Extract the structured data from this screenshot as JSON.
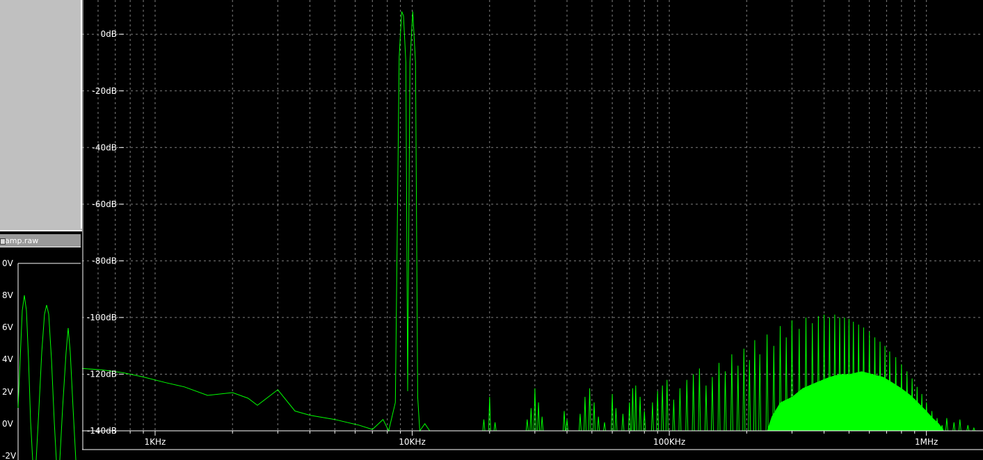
{
  "mini_window": {
    "title": "amp.raw",
    "y_ticks": [
      "0V",
      "8V",
      "6V",
      "4V",
      "2V",
      "0V",
      "-2V"
    ]
  },
  "colors": {
    "background": "#000000",
    "trace": "#00ff00",
    "grid": "#808080",
    "text": "#ffffff",
    "panel": "#c0c0c0"
  },
  "chart_data": {
    "type": "line",
    "title": "",
    "xlabel": "",
    "ylabel": "",
    "x_scale": "log",
    "x_unit": "Hz",
    "xlim": [
      520,
      1660000
    ],
    "ylim": [
      -140,
      10
    ],
    "grid": true,
    "x_tick_labels": [
      {
        "value": 1000,
        "label": "1KHz"
      },
      {
        "value": 10000,
        "label": "10KHz"
      },
      {
        "value": 100000,
        "label": "100KHz"
      },
      {
        "value": 1000000,
        "label": "1MHz"
      }
    ],
    "y_tick_labels": [
      {
        "value": 0,
        "label": "0dB"
      },
      {
        "value": -20,
        "label": "-20dB"
      },
      {
        "value": -40,
        "label": "-40dB"
      },
      {
        "value": -60,
        "label": "-60dB"
      },
      {
        "value": -80,
        "label": "-80dB"
      },
      {
        "value": -100,
        "label": "-100dB"
      },
      {
        "value": -120,
        "label": "-120dB"
      },
      {
        "value": -140,
        "label": "-140dB"
      }
    ],
    "series": [
      {
        "points": [
          [
            520,
            -118
          ],
          [
            620,
            -118.5
          ],
          [
            750,
            -119.5
          ],
          [
            900,
            -121
          ],
          [
            1100,
            -123
          ],
          [
            1300,
            -124.5
          ],
          [
            1600,
            -127.5
          ],
          [
            2000,
            -126.5
          ],
          [
            2300,
            -128.5
          ],
          [
            2500,
            -131
          ],
          [
            3000,
            -125.5
          ],
          [
            3500,
            -133
          ],
          [
            4000,
            -134.5
          ],
          [
            5000,
            -136
          ],
          [
            6200,
            -138
          ],
          [
            7000,
            -139.5
          ],
          [
            7700,
            -136
          ],
          [
            8100,
            -140
          ],
          [
            8600,
            -130
          ],
          [
            8900,
            -8
          ],
          [
            9100,
            8
          ],
          [
            9250,
            6.5
          ],
          [
            9450,
            -10
          ],
          [
            9600,
            -126
          ],
          [
            9800,
            -10
          ],
          [
            10050,
            8
          ],
          [
            10300,
            -10
          ],
          [
            10500,
            -128
          ],
          [
            10700,
            -140
          ],
          [
            11200,
            -137.5
          ],
          [
            11700,
            -140
          ]
        ]
      }
    ],
    "harmonic_peaks": [
      [
        17500,
        -140
      ],
      [
        19000,
        -136
      ],
      [
        20000,
        -128
      ],
      [
        21000,
        -137
      ],
      [
        22000,
        -140
      ],
      [
        28000,
        -136
      ],
      [
        29000,
        -132
      ],
      [
        30000,
        -125
      ],
      [
        31000,
        -130
      ],
      [
        32000,
        -135
      ],
      [
        33000,
        -140
      ],
      [
        37000,
        -140
      ],
      [
        39000,
        -133
      ],
      [
        40000,
        -136
      ],
      [
        45000,
        -134
      ],
      [
        47000,
        -128
      ],
      [
        49000,
        -125
      ],
      [
        51000,
        -130
      ],
      [
        53000,
        -135
      ],
      [
        56000,
        -137
      ],
      [
        60000,
        -127
      ],
      [
        62000,
        -132
      ],
      [
        66000,
        -134
      ],
      [
        70000,
        -130
      ],
      [
        72000,
        -125
      ],
      [
        74000,
        -124
      ],
      [
        77000,
        -128
      ],
      [
        80000,
        -133
      ],
      [
        86000,
        -130
      ],
      [
        90000,
        -126
      ],
      [
        94000,
        -124
      ],
      [
        98000,
        -122
      ],
      [
        104000,
        -129
      ],
      [
        110000,
        -125
      ],
      [
        117000,
        -122
      ],
      [
        124000,
        -120
      ],
      [
        131000,
        -118
      ],
      [
        139000,
        -124
      ],
      [
        147000,
        -121
      ],
      [
        156000,
        -116
      ],
      [
        165000,
        -119
      ],
      [
        175000,
        -113
      ],
      [
        185000,
        -117
      ],
      [
        195000,
        -111
      ],
      [
        205000,
        -115
      ],
      [
        215000,
        -108
      ],
      [
        225000,
        -113
      ],
      [
        240000,
        -106
      ],
      [
        255000,
        -110
      ],
      [
        270000,
        -103
      ],
      [
        285000,
        -107
      ],
      [
        300000,
        -101
      ],
      [
        320000,
        -104
      ],
      [
        340000,
        -100
      ],
      [
        360000,
        -102
      ],
      [
        380000,
        -99.5
      ],
      [
        400000,
        -99
      ],
      [
        420000,
        -100
      ],
      [
        440000,
        -99
      ],
      [
        460000,
        -100
      ],
      [
        480000,
        -100
      ],
      [
        500000,
        -100.5
      ],
      [
        520000,
        -101.5
      ],
      [
        545000,
        -102.5
      ],
      [
        570000,
        -103.5
      ],
      [
        600000,
        -105
      ],
      [
        630000,
        -107
      ],
      [
        660000,
        -108.5
      ],
      [
        690000,
        -110
      ],
      [
        720000,
        -112
      ],
      [
        760000,
        -114
      ],
      [
        800000,
        -116.5
      ],
      [
        840000,
        -119
      ],
      [
        880000,
        -121.5
      ],
      [
        920000,
        -124.5
      ],
      [
        960000,
        -127
      ],
      [
        1000000,
        -130
      ],
      [
        1050000,
        -133
      ],
      [
        1100000,
        -135.5
      ],
      [
        1150000,
        -138
      ],
      [
        1200000,
        -135.5
      ],
      [
        1280000,
        -137
      ],
      [
        1350000,
        -136
      ],
      [
        1450000,
        -138
      ],
      [
        1530000,
        -139
      ]
    ],
    "dense_envelope": [
      [
        240000,
        -140
      ],
      [
        250000,
        -135
      ],
      [
        270000,
        -130
      ],
      [
        300000,
        -128
      ],
      [
        330000,
        -125
      ],
      [
        370000,
        -123
      ],
      [
        420000,
        -121
      ],
      [
        460000,
        -120
      ],
      [
        500000,
        -120
      ],
      [
        560000,
        -119
      ],
      [
        620000,
        -120
      ],
      [
        680000,
        -121
      ],
      [
        740000,
        -123
      ],
      [
        800000,
        -125
      ],
      [
        870000,
        -127.5
      ],
      [
        940000,
        -130.5
      ],
      [
        1000000,
        -133
      ],
      [
        1060000,
        -135.5
      ],
      [
        1120000,
        -137.5
      ],
      [
        1170000,
        -140
      ]
    ]
  }
}
